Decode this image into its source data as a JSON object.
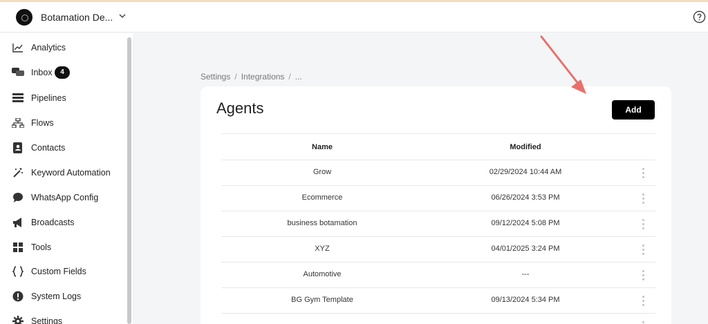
{
  "workspace": {
    "name": "Botamation De..."
  },
  "sidebar": {
    "items": [
      {
        "label": "Analytics",
        "icon": "chart-line-icon"
      },
      {
        "label": "Inbox",
        "icon": "chat-bubbles-icon",
        "badge": "4"
      },
      {
        "label": "Pipelines",
        "icon": "pipeline-icon"
      },
      {
        "label": "Flows",
        "icon": "flow-tree-icon"
      },
      {
        "label": "Contacts",
        "icon": "contact-book-icon"
      },
      {
        "label": "Keyword Automation",
        "icon": "magic-wand-icon"
      },
      {
        "label": "WhatsApp Config",
        "icon": "speech-bubble-icon"
      },
      {
        "label": "Broadcasts",
        "icon": "megaphone-icon"
      },
      {
        "label": "Tools",
        "icon": "grid-icon"
      },
      {
        "label": "Custom Fields",
        "icon": "braces-icon"
      },
      {
        "label": "System Logs",
        "icon": "alert-circle-icon"
      },
      {
        "label": "Settings",
        "icon": "gear-icon"
      }
    ]
  },
  "breadcrumb": [
    "Settings",
    "Integrations",
    "..."
  ],
  "agents": {
    "title": "Agents",
    "add_label": "Add",
    "columns": [
      "Name",
      "Modified"
    ],
    "rows": [
      {
        "name": "Grow",
        "modified": "02/29/2024 10:44 AM"
      },
      {
        "name": "Ecommerce",
        "modified": "06/26/2024 3:53 PM"
      },
      {
        "name": "business botamation",
        "modified": "09/12/2024 5:08 PM"
      },
      {
        "name": "XYZ",
        "modified": "04/01/2025 3:24 PM"
      },
      {
        "name": "Automotive",
        "modified": "---"
      },
      {
        "name": "BG Gym Template",
        "modified": "09/13/2024 5:34 PM"
      }
    ]
  },
  "colors": {
    "accent": "#000000",
    "annotation_arrow": "#e8706c"
  }
}
